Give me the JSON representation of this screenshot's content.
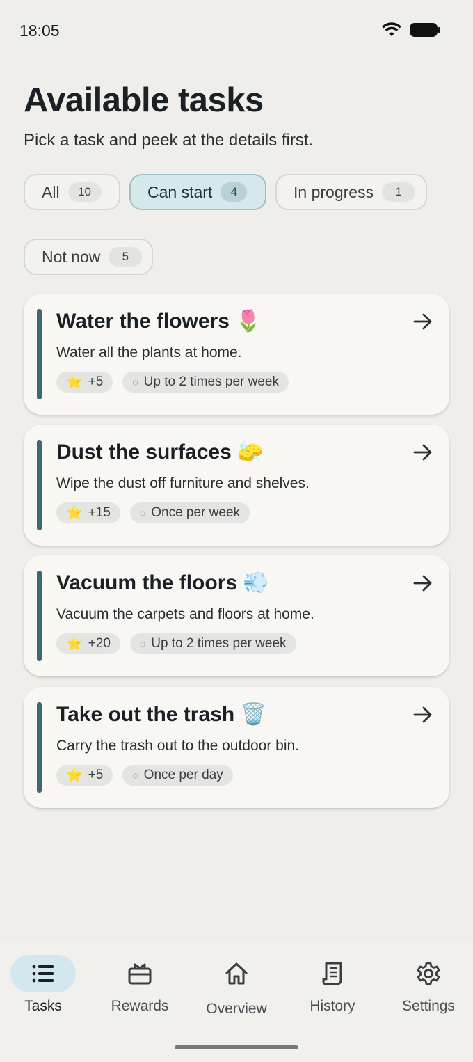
{
  "status": {
    "time": "18:05",
    "wifi_icon": "wifi-icon",
    "battery_icon": "battery-icon"
  },
  "header": {
    "title": "Available tasks",
    "subtitle": "Pick a task and peek at the details first."
  },
  "filters": [
    {
      "label": "All",
      "count": "10",
      "active": false
    },
    {
      "label": "Can start",
      "count": "4",
      "active": true
    },
    {
      "label": "In progress",
      "count": "1",
      "active": false
    },
    {
      "label": "Not now",
      "count": "5",
      "active": false
    }
  ],
  "tasks": [
    {
      "title": "Water the flowers 🌷",
      "description": "Water all the plants at home.",
      "points": "+5",
      "frequency": "Up to 2 times per week"
    },
    {
      "title": "Dust the surfaces 🧽",
      "description": "Wipe the dust off furniture and shelves.",
      "points": "+15",
      "frequency": "Once per week"
    },
    {
      "title": "Vacuum the floors 💨",
      "description": "Vacuum the carpets and floors at home.",
      "points": "+20",
      "frequency": "Up to 2 times per week"
    },
    {
      "title": "Take out the trash 🗑️",
      "description": "Carry the trash out to the outdoor bin.",
      "points": "+5",
      "frequency": "Once per day"
    }
  ],
  "nav": [
    {
      "label": "Tasks",
      "icon": "list-icon",
      "active": true
    },
    {
      "label": "Rewards",
      "icon": "gift-icon",
      "active": false
    },
    {
      "label": "Overview",
      "icon": "home-icon",
      "active": false
    },
    {
      "label": "History",
      "icon": "receipt-icon",
      "active": false
    },
    {
      "label": "Settings",
      "icon": "gear-icon",
      "active": false
    }
  ],
  "colors": {
    "accent": "#3f6870",
    "active_chip_bg": "#d6e8ec",
    "background": "#efeeeb",
    "card": "#f8f7f3"
  }
}
